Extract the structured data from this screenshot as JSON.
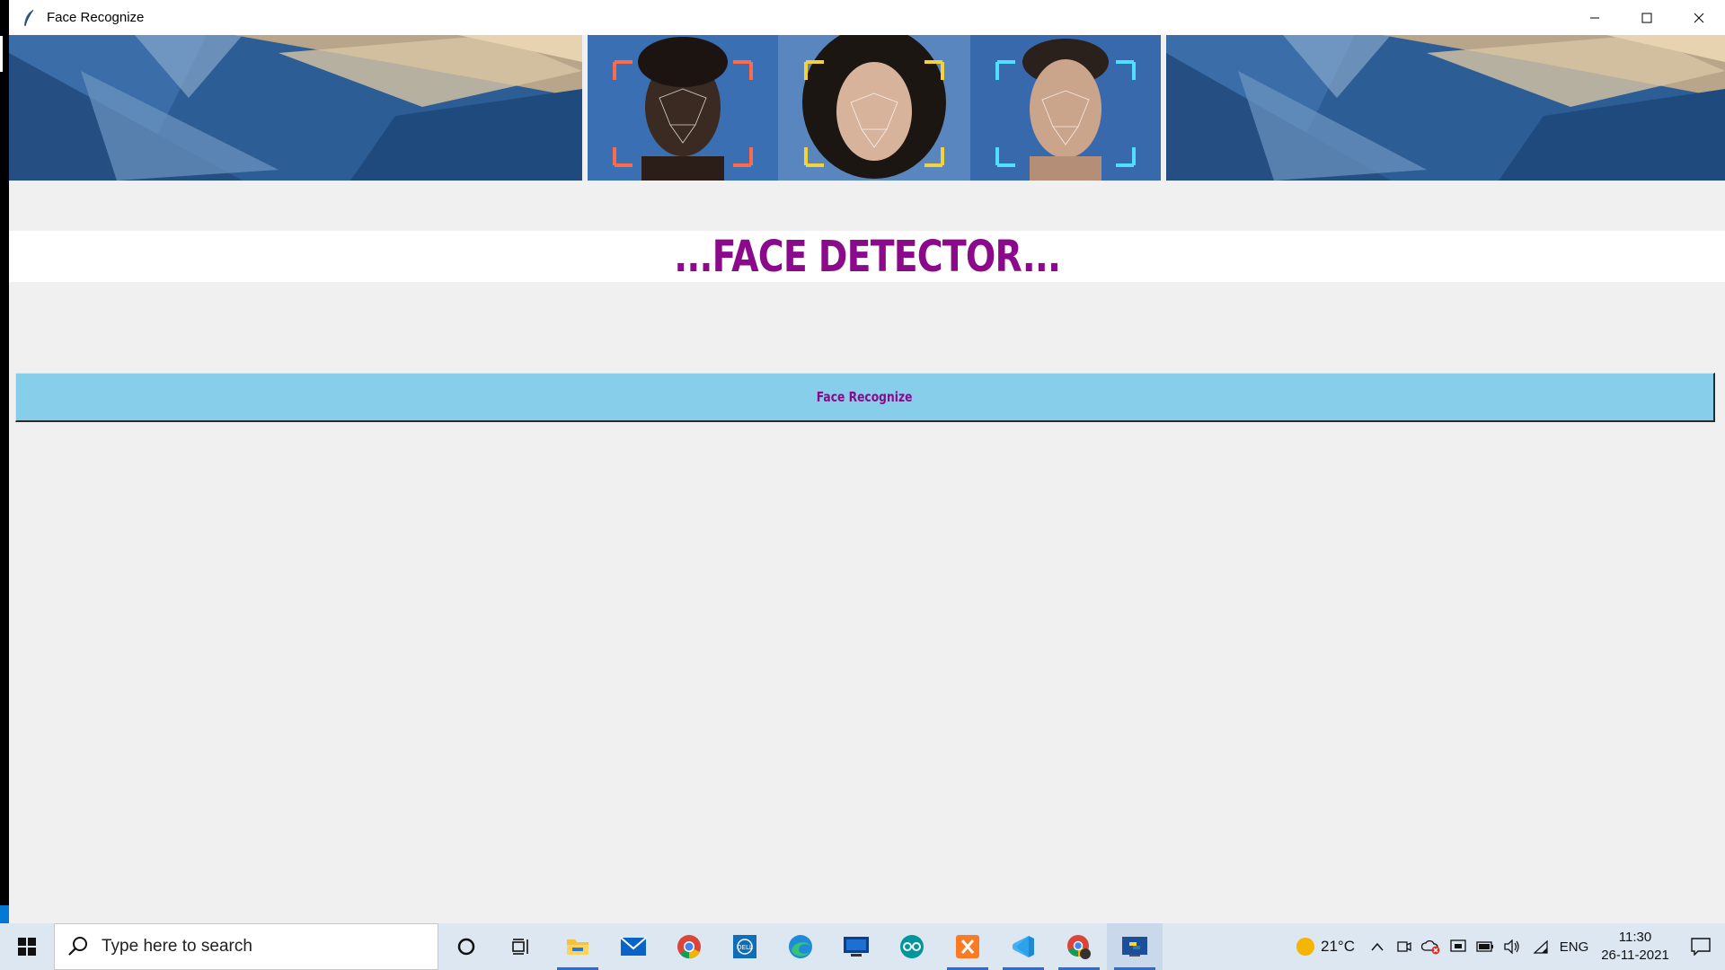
{
  "window": {
    "title": "Face Recognize"
  },
  "main": {
    "heading": "...FACE DETECTOR...",
    "button_label": "Face Recognize"
  },
  "colors": {
    "heading": "#8b0a8b",
    "button_bg": "#87ceeb",
    "window_bg": "#f0f0f0",
    "taskbar_bg": "#dde7f2"
  },
  "taskbar": {
    "search_placeholder": "Type here to search",
    "apps": [
      "cortana-icon",
      "task-view-icon",
      "file-explorer-icon",
      "mail-icon",
      "chrome-icon",
      "dell-icon",
      "edge-icon",
      "vm-icon",
      "arduino-icon",
      "xampp-icon",
      "vscode-icon",
      "chrome-profile-icon",
      "python-icon"
    ],
    "weather": "21°C",
    "language": "ENG",
    "time": "11:30",
    "date": "26-11-2021"
  }
}
